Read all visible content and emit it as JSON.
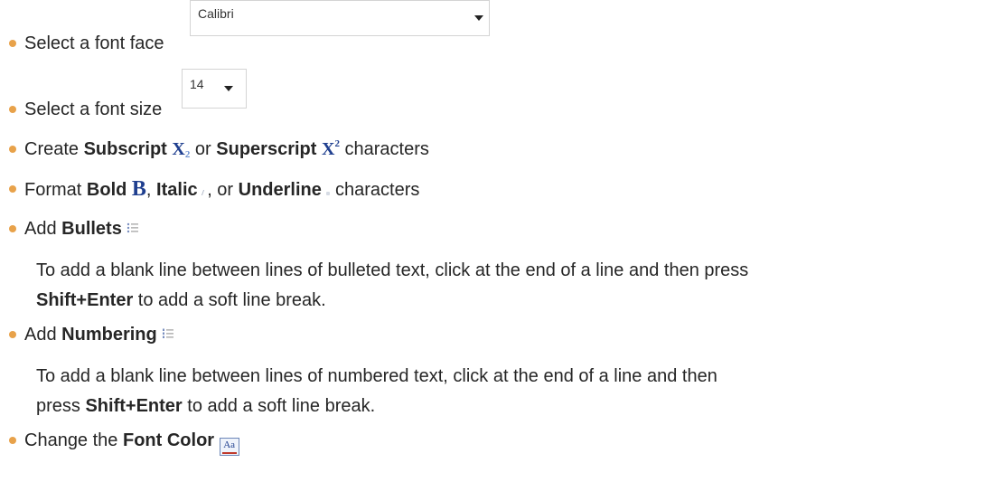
{
  "items": {
    "font_face": {
      "label": "Select a font face",
      "value": "Calibri"
    },
    "font_size": {
      "label": "Select a font size",
      "value": "14"
    },
    "script": {
      "p1": "Create ",
      "b1": "Subscript",
      "p2": " or ",
      "b2": "Superscript",
      "p3": " characters",
      "sub_icon": {
        "base": "X",
        "mark": "2"
      },
      "sup_icon": {
        "base": "X",
        "mark": "2"
      }
    },
    "format": {
      "p1": "Format ",
      "b1": "Bold",
      "p2": ", ",
      "b2": "Italic",
      "p3": ", or ",
      "b3": "Underline",
      "p4": " characters",
      "bold_icon": "B"
    },
    "bullets": {
      "p1": "Add ",
      "b1": "Bullets",
      "note_p1": "To add a blank line between lines of bulleted text, click at the end of a line and then press",
      "note_b": "Shift+Enter",
      "note_p2": " to add a soft line break."
    },
    "numbering": {
      "p1": "Add ",
      "b1": "Numbering",
      "note_p1": "To add a blank line between lines of numbered text, click at the end of a line and then",
      "note_p2": "press ",
      "note_b": "Shift+Enter",
      "note_p3": " to add a soft line break."
    },
    "font_color": {
      "p1": "Change the ",
      "b1": "Font Color",
      "icon": "Aa"
    }
  },
  "colors": {
    "bullet": "#e8a24a",
    "text": "#262626",
    "icon_blue": "#1f3f8f"
  }
}
